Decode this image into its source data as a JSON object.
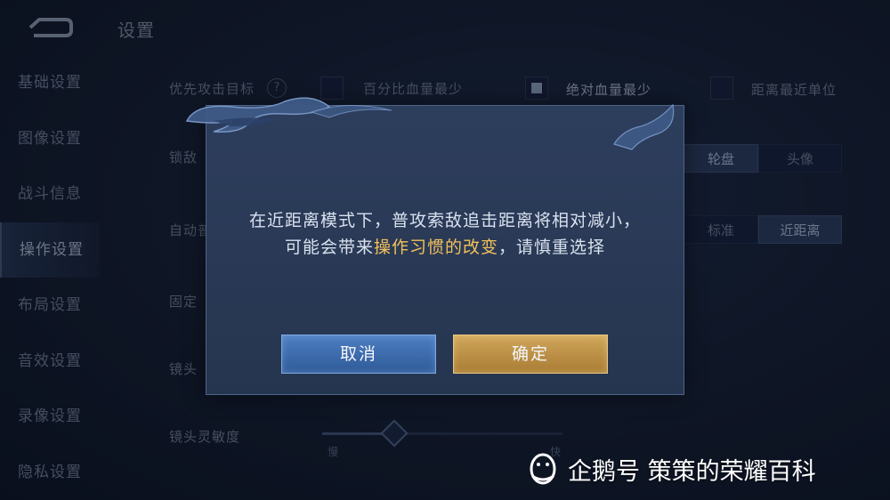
{
  "header": {
    "title": "设置"
  },
  "sidebar": {
    "items": [
      {
        "label": "基础设置"
      },
      {
        "label": "图像设置"
      },
      {
        "label": "战斗信息"
      },
      {
        "label": "操作设置"
      },
      {
        "label": "布局设置"
      },
      {
        "label": "音效设置"
      },
      {
        "label": "录像设置"
      },
      {
        "label": "隐私设置"
      }
    ],
    "active_index": 3
  },
  "settings": {
    "target_priority": {
      "label": "优先攻击目标",
      "help": "?",
      "options": [
        {
          "label": "百分比血量最少",
          "checked": false
        },
        {
          "label": "绝对血量最少",
          "checked": true
        },
        {
          "label": "距离最近单位",
          "checked": false
        }
      ]
    },
    "lock_enemy": {
      "label": "锁敌",
      "options": [
        "轮盘",
        "头像"
      ],
      "selected": "轮盘"
    },
    "auto_attack": {
      "label": "自动普",
      "options": [
        "标准",
        "近距离"
      ],
      "selected": "近距离"
    },
    "fixed": {
      "label": "固定"
    },
    "camera": {
      "label": "镜头"
    },
    "camera_sensitivity": {
      "label": "镜头灵敏度",
      "min_label": "慢",
      "max_label": "快",
      "value": 0.3
    }
  },
  "dialog": {
    "line1": "在近距离模式下，普攻索敌追击距离将相对减小，",
    "line2_prefix": "可能会带来",
    "line2_highlight": "操作习惯的改变",
    "line2_suffix": "，请慎重选择",
    "cancel_label": "取消",
    "confirm_label": "确定"
  },
  "watermark": {
    "text": "企鹅号 策策的荣耀百科"
  },
  "colors": {
    "highlight": "#f2c05a",
    "cancel": "#3d6db0",
    "confirm": "#c0964a"
  }
}
